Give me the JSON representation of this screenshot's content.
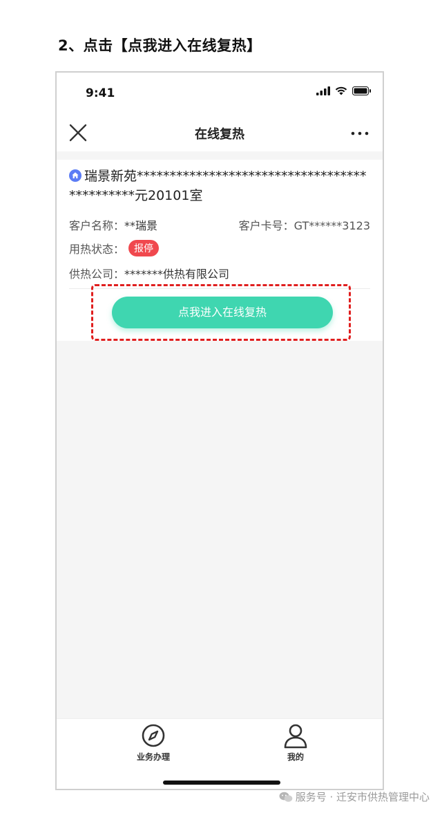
{
  "step_heading": "2、点击【点我进入在线复热】",
  "status_bar": {
    "time": "9:41"
  },
  "nav": {
    "title": "在线复热"
  },
  "account": {
    "address": "瑞景新苑*********************************************元20101室",
    "customer_name_label": "客户名称：",
    "customer_name_value": "**瑞景",
    "card_no_label": "客户卡号：",
    "card_no_value": "GT******3123",
    "heating_status_label": "用热状态：",
    "heating_status_badge": "报停",
    "company_label": "供热公司：",
    "company_value": "*******供热有限公司"
  },
  "enter_button": {
    "label": "点我进入在线复热"
  },
  "tabs": [
    {
      "label": "业务办理",
      "icon": "compass-icon"
    },
    {
      "label": "我的",
      "icon": "person-icon"
    }
  ],
  "watermark": "服务号 · 迁安市供热管理中心",
  "colors": {
    "accent": "#3fd6b0",
    "badge": "#f0484e",
    "highlight": "#e01e1e",
    "home_icon": "#5b7cf5"
  }
}
